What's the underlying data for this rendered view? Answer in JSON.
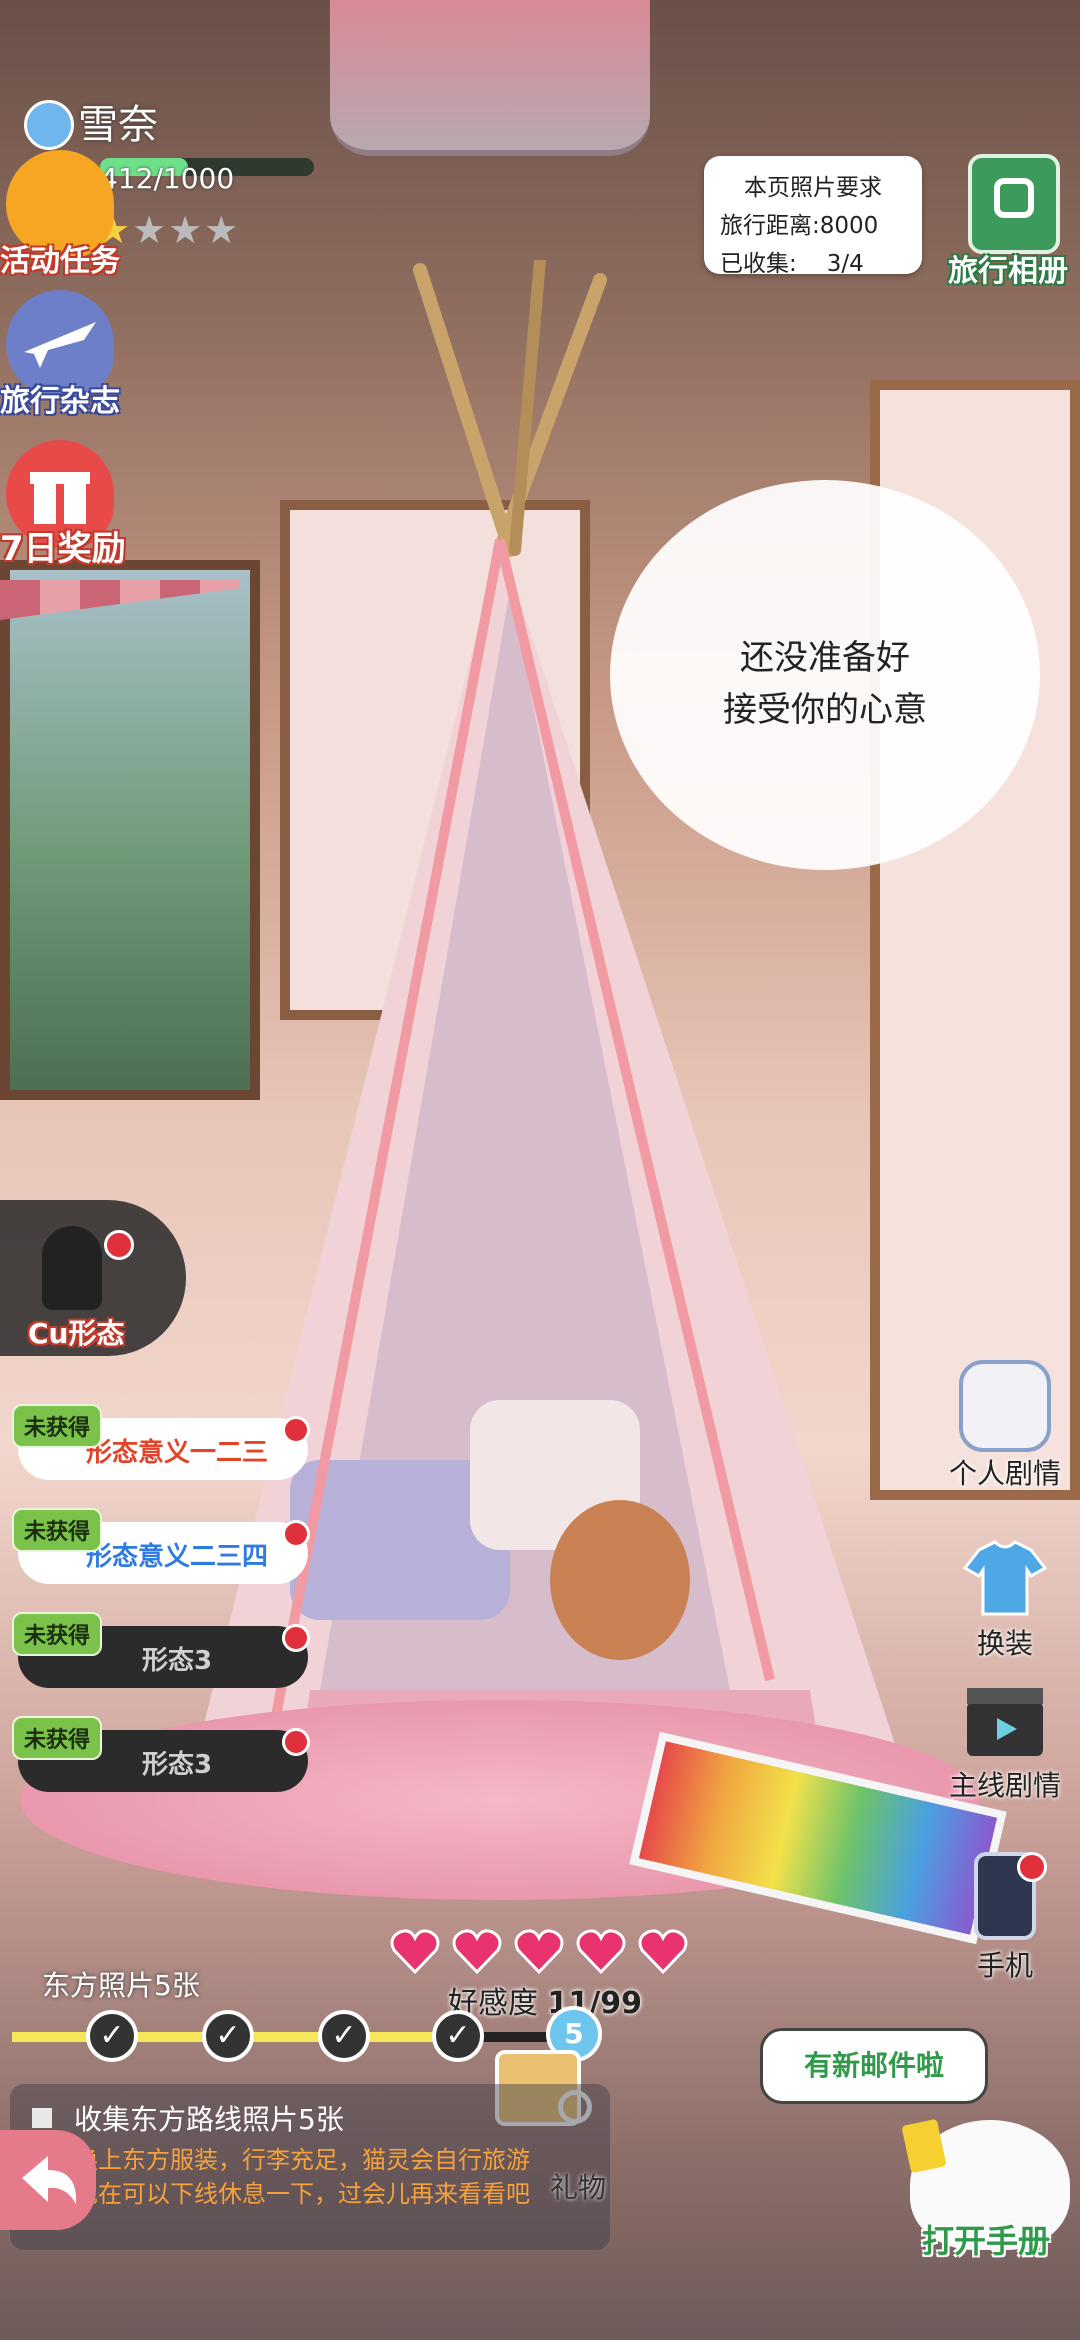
{
  "player": {
    "name": "雪奈",
    "exp": "412/1000",
    "stars_filled": 1,
    "stars_total": 5
  },
  "left_menu": [
    {
      "label": "活动任务",
      "icon": "mission-icon"
    },
    {
      "label": "旅行杂志",
      "icon": "airplane-icon"
    },
    {
      "label": "7日奖励",
      "icon": "gift-icon"
    }
  ],
  "photo_req": {
    "title": "本页照片要求",
    "distance_label": "旅行距离:",
    "distance_value": "8000",
    "collected_label": "已收集:",
    "collected_value": "3/4"
  },
  "album_button": {
    "label": "旅行相册"
  },
  "speech_bubble": {
    "line1": "还没准备好",
    "line2": "接受你的心意"
  },
  "form_panel": {
    "title": "Cu形态",
    "items": [
      {
        "tag": "未获得",
        "name": "形态意义一二三",
        "style": "white-red"
      },
      {
        "tag": "未获得",
        "name": "形态意义二三四",
        "style": "white-blue"
      },
      {
        "tag": "未获得",
        "name": "形态3",
        "style": "dark"
      },
      {
        "tag": "未获得",
        "name": "形态3",
        "style": "dark"
      }
    ]
  },
  "right_menu": [
    {
      "label": "个人剧情",
      "icon": "dice-icon"
    },
    {
      "label": "换装",
      "icon": "shirt-icon"
    },
    {
      "label": "主线剧情",
      "icon": "clapperboard-icon"
    },
    {
      "label": "手机",
      "icon": "phone-icon"
    }
  ],
  "affection": {
    "label": "好感度",
    "value": "11/99",
    "hearts": 5
  },
  "progress": {
    "label": "东方照片5张",
    "milestones_done": 4,
    "current_level": "5"
  },
  "gift": {
    "label": "礼物"
  },
  "task": {
    "title": "收集东方路线照片5张",
    "line1": "换上东方服装，行李充足，猫灵会自行旅游",
    "line2": "现在可以下线休息一下，过会儿再来看看吧"
  },
  "mail_notice": {
    "text": "有新邮件啦"
  },
  "manual_button": {
    "label": "打开手册"
  },
  "colors": {
    "accent": "#2e9a4a",
    "heart": "#e8336e",
    "progress": "#f5e65a"
  }
}
